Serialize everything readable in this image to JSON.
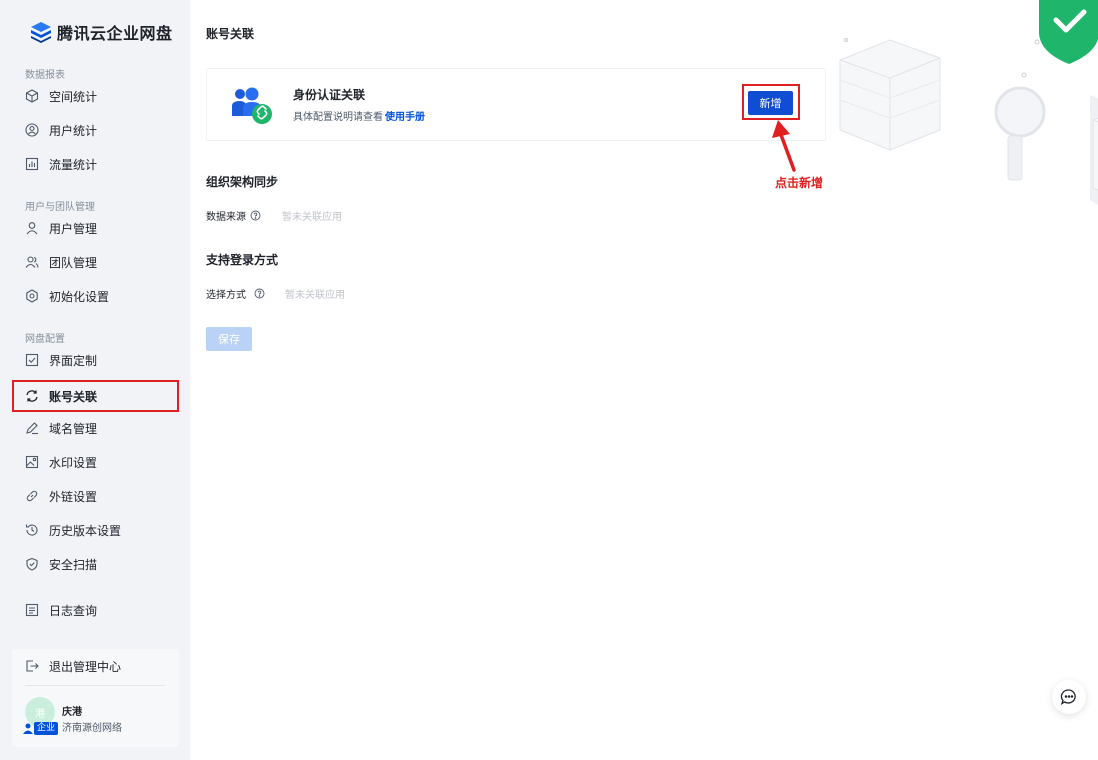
{
  "app": {
    "name": "腾讯云企业网盘"
  },
  "sidebar": {
    "groups": [
      {
        "title": "数据报表",
        "items": [
          {
            "label": "空间统计",
            "icon": "cube-icon"
          },
          {
            "label": "用户统计",
            "icon": "user-circle-icon"
          },
          {
            "label": "流量统计",
            "icon": "bar-chart-icon"
          }
        ]
      },
      {
        "title": "用户与团队管理",
        "items": [
          {
            "label": "用户管理",
            "icon": "user-icon"
          },
          {
            "label": "团队管理",
            "icon": "team-icon"
          },
          {
            "label": "初始化设置",
            "icon": "settings-icon"
          }
        ]
      },
      {
        "title": "网盘配置",
        "items": [
          {
            "label": "界面定制",
            "icon": "check-square-icon"
          },
          {
            "label": "账号关联",
            "icon": "sync-icon",
            "active": true
          },
          {
            "label": "域名管理",
            "icon": "edit-icon"
          },
          {
            "label": "水印设置",
            "icon": "image-icon"
          },
          {
            "label": "外链设置",
            "icon": "link-icon"
          },
          {
            "label": "历史版本设置",
            "icon": "history-icon"
          },
          {
            "label": "安全扫描",
            "icon": "shield-icon"
          }
        ]
      }
    ],
    "log_query": "日志查询",
    "logout": "退出管理中心",
    "user": {
      "avatar_text": "港",
      "name": "庆港",
      "org": "济南源创网络",
      "badge": "企业"
    }
  },
  "main": {
    "page_title": "账号关联",
    "auth_card": {
      "title": "身份认证关联",
      "desc": "具体配置说明请查看",
      "link": "使用手册",
      "add_button": "新增"
    },
    "annotation": "点击新增",
    "org_sync": {
      "title": "组织架构同步",
      "field_label": "数据来源",
      "field_value": "暂未关联应用"
    },
    "login": {
      "title": "支持登录方式",
      "field_label": "选择方式",
      "field_value": "暂未关联应用"
    },
    "save_button": "保存"
  },
  "colors": {
    "primary": "#0f4ed2",
    "highlight": "#e02020",
    "sidebar_bg": "#f1f3f7",
    "shield_green": "#1fb56b"
  }
}
